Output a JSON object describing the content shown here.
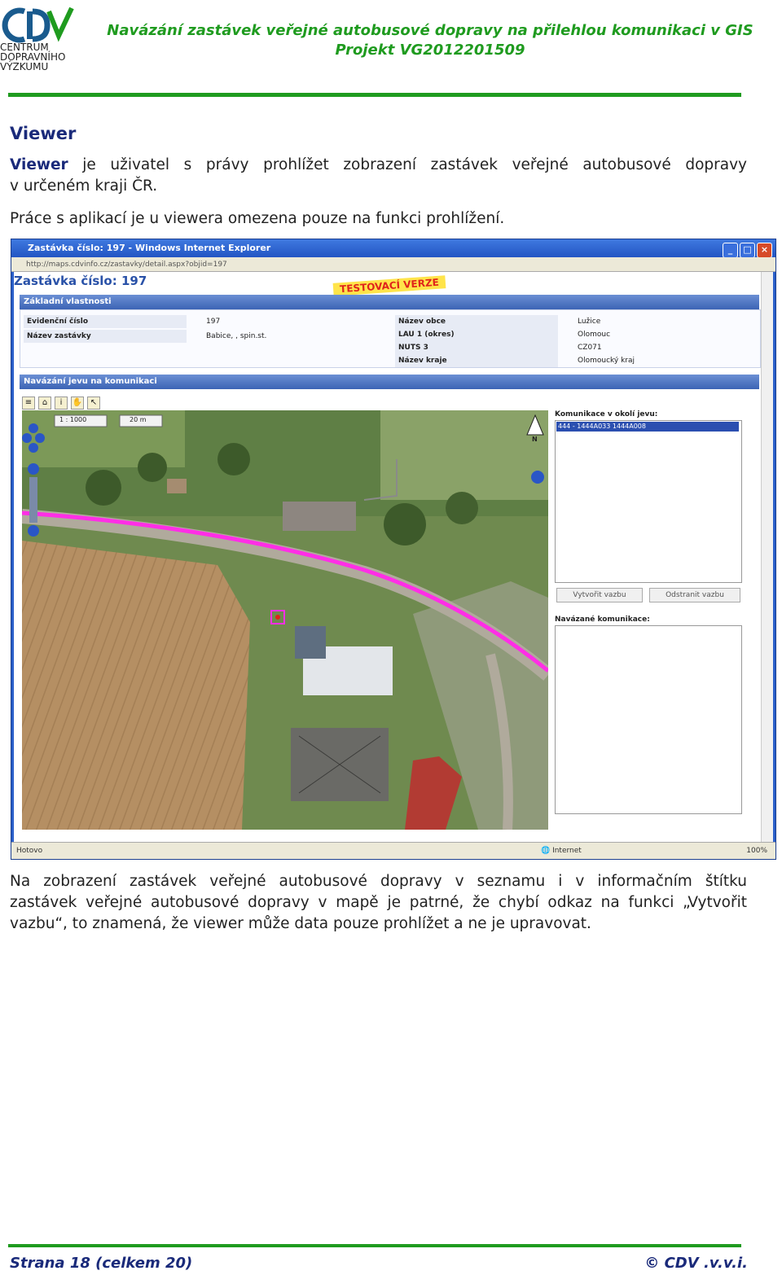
{
  "header": {
    "logo_text": "CENTRUM DOPRAVNÍHO VÝZKUMU",
    "title": "Navázání zastávek veřejné autobusové dopravy na přilehlou komunikaci v GIS",
    "subtitle": "Projekt VG2012201509"
  },
  "section": {
    "heading": "Viewer",
    "p1_bold": "Viewer",
    "p1_rest": " je uživatel s právy prohlížet zobrazení zastávek veřejné autobusové dopravy",
    "p1_line2": "v určeném kraji ČR.",
    "p2": "Práce s aplikací je u viewera omezena pouze na funkci prohlížení.",
    "p3_line1": "Na zobrazení zastávek veřejné autobusové dopravy v seznamu i v informačním štítku",
    "p3_line2": "zastávek veřejné autobusové dopravy v mapě je patrné, že chybí odkaz na funkci „Vytvořit",
    "p3_line3": "vazbu“, to znamená, že viewer může data pouze prohlížet a ne je upravovat."
  },
  "screenshot": {
    "window_title": "Zastávka číslo: 197 - Windows Internet Explorer",
    "address": "http://maps.cdvinfo.cz/zastavky/detail.aspx?objid=197",
    "page_title": "Zastávka číslo: 197",
    "badge": "TESTOVACÍ VERZE",
    "panel1": "Základní vlastnosti",
    "props_left": [
      {
        "key": "Evidenční číslo",
        "value": "197"
      },
      {
        "key": "Název zastávky",
        "value": "Babice, , spin.st."
      }
    ],
    "props_right": [
      {
        "key": "Název obce",
        "value": "Lužice"
      },
      {
        "key": "LAU 1 (okres)",
        "value": "Olomouc"
      },
      {
        "key": "NUTS 3",
        "value": "CZ071"
      },
      {
        "key": "Název kraje",
        "value": "Olomoucký kraj"
      }
    ],
    "panel2": "Navázání jevu na komunikaci",
    "scale": "1 : 1000",
    "scale_bar": "20 m",
    "north": "N",
    "list1_label": "Komunikace v okolí jevu:",
    "list1_selected": "444 - 1444A033 1444A008",
    "btn_create": "Vytvořit vazbu",
    "btn_remove": "Odstranit vazbu",
    "list2_label": "Navázané komunikace:",
    "status_left": "Hotovo",
    "status_zone": "Internet",
    "status_zoom": "100%"
  },
  "footer": {
    "page": "Strana 18 (celkem 20)",
    "copyright": "© CDV .v.v.i."
  },
  "colors": {
    "brand_green": "#1f9b1f",
    "heading_blue": "#1a2a7a",
    "road_magenta": "#ff2ee6"
  }
}
